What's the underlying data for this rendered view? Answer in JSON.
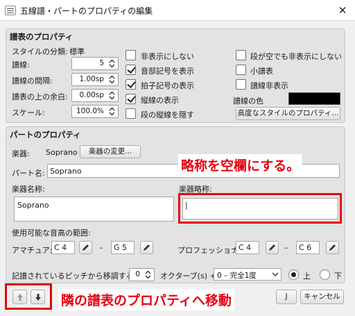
{
  "window": {
    "title": "五線譜・パートのプロパティの編集",
    "close": "✕"
  },
  "staff": {
    "group_title": "譜表のプロパティ",
    "style_category_label": "スタイルの分類:",
    "style_category_value": "標準",
    "lines_label": "譜線:",
    "lines_value": "5",
    "line_spacing_label": "譜線の間隔:",
    "line_spacing_value": "1.00sp",
    "top_margin_label": "譜表の上の余白:",
    "top_margin_value": "0.00sp",
    "scale_label": "スケール:",
    "scale_value": "100.0%",
    "checks_col1": [
      {
        "label": "非表示にしない",
        "checked": false
      },
      {
        "label": "音部記号を表示",
        "checked": true
      },
      {
        "label": "拍子記号の表示",
        "checked": true
      },
      {
        "label": "縦線の表示",
        "checked": true
      },
      {
        "label": "段の縦線を隠す",
        "checked": false
      }
    ],
    "checks_col2": [
      {
        "label": "段が空でも非表示にしない",
        "checked": false
      },
      {
        "label": "小譜表",
        "checked": false
      },
      {
        "label": "譜線非表示",
        "checked": false
      }
    ],
    "staff_color_label": "譜線の色",
    "staff_color": "#000000",
    "advanced_button": "高度なスタイルのプロパティ..."
  },
  "part": {
    "group_title": "パートのプロパティ",
    "instrument_label": "楽器:",
    "instrument_value": "Soprano",
    "change_instrument_button": "楽器の変更...",
    "part_name_label": "パート名:",
    "part_name_value": "Soprano",
    "long_name_label": "楽器名称:",
    "long_name_value": "Soprano",
    "short_name_label": "楽器略称:",
    "short_name_value": "|",
    "range_label": "使用可能な音高の範囲:",
    "amateur_label": "アマチュア:",
    "amateur_low": "C 4",
    "amateur_high": "G 5",
    "pro_label": "プロフェッショナル:",
    "pro_low": "C 4",
    "pro_high": "C 6",
    "dash": "–",
    "transpose_label": "記譜されているピッチから移調する:",
    "transpose_octaves": "0",
    "octaves_label": "オクターブ(s) +",
    "interval_value": "0 – 完全1度",
    "up_label": "上",
    "down_label": "下",
    "direction": "up"
  },
  "buttons": {
    "ok_partial": "J",
    "cancel": "キャンセル"
  },
  "annotations": {
    "callout_top": "略称を空欄にする。",
    "callout_bottom": "隣の譜表のプロパティへ移動",
    "accent": "#e60012"
  }
}
